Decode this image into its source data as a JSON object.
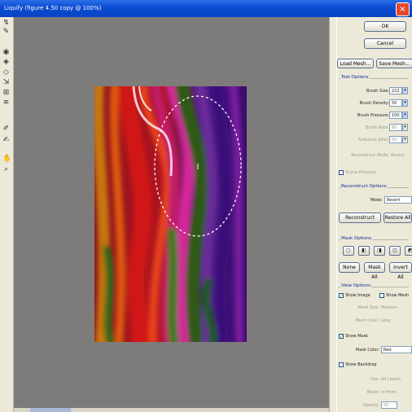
{
  "window": {
    "title": "Liquify (figure 4.50 copy @ 100%)",
    "close_glyph": "×"
  },
  "tools": [
    {
      "icon": "forward-warp-tool-icon",
      "glyph": "↯"
    },
    {
      "icon": "reconstruct-tool-icon",
      "glyph": "✎"
    },
    {
      "icon": "twirl-tool-icon",
      "glyph": "◉"
    },
    {
      "icon": "pucker-tool-icon",
      "glyph": "◈"
    },
    {
      "icon": "bloat-tool-icon",
      "glyph": "◇"
    },
    {
      "icon": "push-left-tool-icon",
      "glyph": "⇲"
    },
    {
      "icon": "mirror-tool-icon",
      "glyph": "⊞"
    },
    {
      "icon": "turbulence-tool-icon",
      "glyph": "≋"
    },
    {
      "icon": "freeze-mask-tool-icon",
      "glyph": "✐"
    },
    {
      "icon": "thaw-mask-tool-icon",
      "glyph": "✍"
    },
    {
      "icon": "hand-tool-icon",
      "glyph": "✋"
    },
    {
      "icon": "zoom-tool-icon",
      "glyph": "⌕"
    }
  ],
  "buttons": {
    "ok": "OK",
    "cancel": "Cancel",
    "load_mesh": "Load Mesh...",
    "save_mesh": "Save Mesh...",
    "reconstruct": "Reconstruct",
    "restore_all": "Restore All",
    "none": "None",
    "mask_all": "Mask All",
    "invert_all": "Invert All"
  },
  "tool_options": {
    "title": "Tool Options",
    "brush_size": {
      "label": "Brush Size:",
      "value": "222"
    },
    "brush_density": {
      "label": "Brush Density:",
      "value": "50"
    },
    "brush_pressure": {
      "label": "Brush Pressure:",
      "value": "100"
    },
    "brush_rate": {
      "label": "Brush Rate:",
      "value": "80"
    },
    "turbulent_jitter": {
      "label": "Turbulent Jitter:",
      "value": "50"
    },
    "reconstruct_mode": {
      "label": "Reconstruct Mode:",
      "value": "Revert"
    },
    "stylus_pressure": "Stylus Pressure"
  },
  "reconstruct_options": {
    "title": "Reconstruct Options",
    "mode": {
      "label": "Mode:",
      "value": "Revert"
    }
  },
  "mask_options": {
    "title": "Mask Options"
  },
  "view_options": {
    "title": "View Options",
    "show_image": "Show Image",
    "show_mesh": "Show Mesh",
    "mesh_size": {
      "label": "Mesh Size:",
      "value": "Medium"
    },
    "mesh_color": {
      "label": "Mesh Color:",
      "value": "Gray"
    },
    "show_mask": "Show Mask",
    "mask_color": {
      "label": "Mask Color:",
      "value": "Red"
    },
    "show_backdrop": "Show Backdrop",
    "use": {
      "label": "Use:",
      "value": "All Layers"
    },
    "mode": {
      "label": "Mode:",
      "value": "In Front"
    },
    "opacity": {
      "label": "Opacity:",
      "value": "50"
    }
  }
}
